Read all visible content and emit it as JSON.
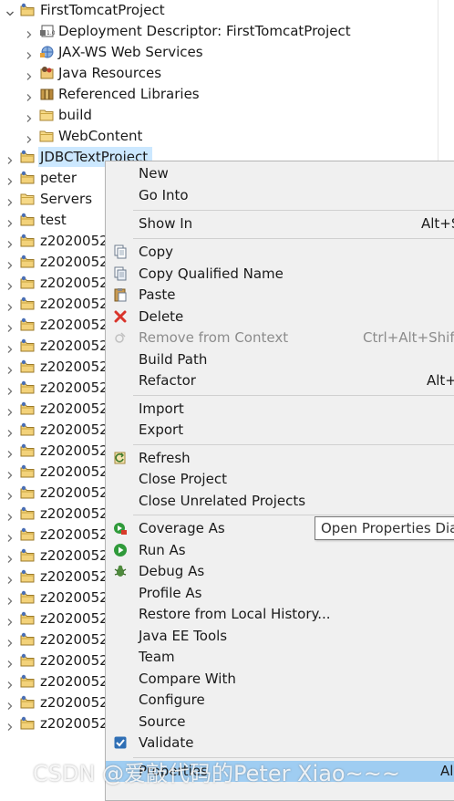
{
  "tree": {
    "rows": [
      {
        "label": "FirstTomcatProject",
        "expanded": true,
        "icon": "project-icon"
      },
      {
        "label": "Deployment Descriptor: FirstTomcatProject",
        "icon": "deployment-descriptor-icon"
      },
      {
        "label": "JAX-WS Web Services",
        "icon": "web-services-icon"
      },
      {
        "label": "Java Resources",
        "icon": "java-resources-icon"
      },
      {
        "label": "Referenced Libraries",
        "icon": "library-icon"
      },
      {
        "label": "build",
        "icon": "folder-icon"
      },
      {
        "label": "WebContent",
        "icon": "folder-icon"
      },
      {
        "label": "JDBCTextProject",
        "selected": true,
        "icon": "project-icon"
      },
      {
        "label": "peter",
        "icon": "project-icon"
      },
      {
        "label": "Servers",
        "icon": "folder-icon"
      },
      {
        "label": "test",
        "icon": "project-icon"
      },
      {
        "label": "z2020052",
        "icon": "project-icon"
      },
      {
        "label": "z2020052",
        "icon": "project-icon"
      },
      {
        "label": "z2020052",
        "icon": "project-icon"
      },
      {
        "label": "z2020052",
        "icon": "project-icon"
      },
      {
        "label": "z2020052",
        "icon": "project-icon"
      },
      {
        "label": "z2020052",
        "icon": "project-icon"
      },
      {
        "label": "z2020052",
        "icon": "project-icon"
      },
      {
        "label": "z2020052",
        "icon": "project-icon"
      },
      {
        "label": "z2020052",
        "icon": "project-icon"
      },
      {
        "label": "z2020052",
        "icon": "project-icon"
      },
      {
        "label": "z2020052",
        "icon": "project-icon"
      },
      {
        "label": "z2020052",
        "icon": "project-icon"
      },
      {
        "label": "z2020052",
        "icon": "project-icon"
      },
      {
        "label": "z2020052",
        "icon": "project-icon"
      },
      {
        "label": "z2020052",
        "icon": "project-icon"
      },
      {
        "label": "z2020052",
        "icon": "project-icon"
      },
      {
        "label": "z2020052",
        "icon": "project-icon"
      },
      {
        "label": "z2020052",
        "icon": "project-icon"
      },
      {
        "label": "z2020052",
        "icon": "project-icon"
      },
      {
        "label": "z2020052",
        "icon": "project-icon"
      },
      {
        "label": "z2020052",
        "icon": "project-icon"
      },
      {
        "label": "z2020052",
        "icon": "project-icon"
      },
      {
        "label": "z2020052",
        "icon": "project-icon"
      },
      {
        "label": "z2020052",
        "icon": "project-icon"
      }
    ]
  },
  "context_menu": {
    "items": [
      {
        "label": "New"
      },
      {
        "label": "Go Into"
      },
      {
        "sep": true
      },
      {
        "label": "Show In",
        "shortcut": "Alt+S"
      },
      {
        "sep": true
      },
      {
        "label": "Copy",
        "icon": "copy-icon"
      },
      {
        "label": "Copy Qualified Name",
        "icon": "copy-qualified-name-icon"
      },
      {
        "label": "Paste",
        "icon": "paste-icon"
      },
      {
        "label": "Delete",
        "icon": "delete-icon"
      },
      {
        "label": "Remove from Context",
        "shortcut": "Ctrl+Alt+Shift",
        "disabled": true,
        "icon": "remove-from-context-icon"
      },
      {
        "label": "Build Path"
      },
      {
        "label": "Refactor",
        "shortcut": "Alt+"
      },
      {
        "sep": true
      },
      {
        "label": "Import"
      },
      {
        "label": "Export"
      },
      {
        "sep": true
      },
      {
        "label": "Refresh",
        "icon": "refresh-icon"
      },
      {
        "label": "Close Project"
      },
      {
        "label": "Close Unrelated Projects"
      },
      {
        "sep": true
      },
      {
        "label": "Coverage As",
        "icon": "coverage-icon"
      },
      {
        "label": "Run As",
        "icon": "run-icon"
      },
      {
        "label": "Debug As",
        "icon": "debug-icon"
      },
      {
        "label": "Profile As"
      },
      {
        "label": "Restore from Local History..."
      },
      {
        "label": "Java EE Tools"
      },
      {
        "label": "Team"
      },
      {
        "label": "Compare With"
      },
      {
        "label": "Configure"
      },
      {
        "label": "Source"
      },
      {
        "label": "Validate",
        "icon": "checkmark-icon"
      },
      {
        "sep": true
      },
      {
        "label": "Properties",
        "shortcut": "Al",
        "highlighted": true
      }
    ]
  },
  "tooltip": {
    "text": "Open Properties Dia"
  },
  "watermark": {
    "text": "CSDN @爱敲代码的Peter Xiao~~~"
  },
  "colors": {
    "selection": "#cce8ff",
    "menu_bg": "#f0f0f0",
    "menu_highlight": "#9fcdf2"
  }
}
